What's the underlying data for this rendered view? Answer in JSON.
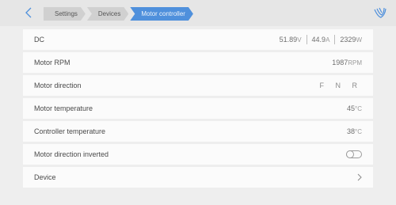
{
  "breadcrumbs": [
    "Settings",
    "Devices",
    "Motor controller"
  ],
  "rows": {
    "dc": {
      "label": "DC",
      "voltage": "51.89",
      "voltage_unit": "V",
      "current": "44.9",
      "current_unit": "A",
      "power": "2329",
      "power_unit": "W"
    },
    "rpm": {
      "label": "Motor RPM",
      "value": "1987",
      "unit": "RPM"
    },
    "direction": {
      "label": "Motor direction",
      "value": "F N R"
    },
    "motor_temp": {
      "label": "Motor temperature",
      "value": "45",
      "unit": "°C"
    },
    "controller_temp": {
      "label": "Controller temperature",
      "value": "38",
      "unit": "°C"
    },
    "direction_inverted": {
      "label": "Motor direction inverted",
      "enabled": false
    },
    "device": {
      "label": "Device"
    }
  },
  "colors": {
    "accent": "#4f90dc",
    "background": "#eeeeee",
    "row": "#fbfbfb"
  },
  "icons": {
    "back": "chevron-left-icon",
    "brand": "victron-logo-icon",
    "device": "chevron-right-icon"
  }
}
